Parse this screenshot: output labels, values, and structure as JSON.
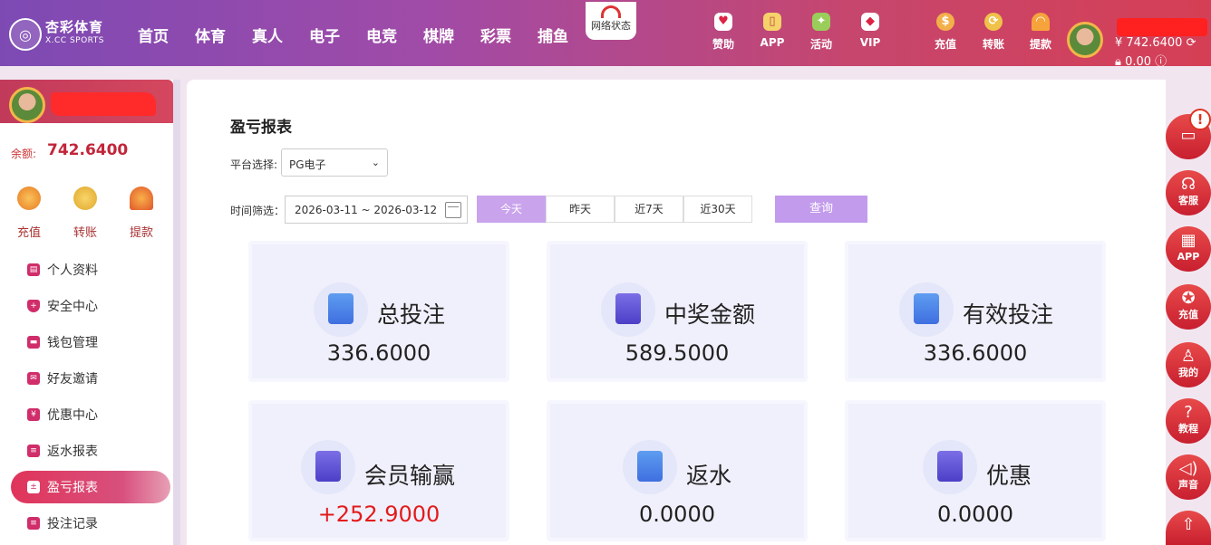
{
  "brand": {
    "cn": "杏彩体育",
    "en": "X.CC SPORTS"
  },
  "nav": [
    "首页",
    "体育",
    "真人",
    "电子",
    "电竞",
    "棋牌",
    "彩票",
    "捕鱼"
  ],
  "net_status": "网络状态",
  "top_icons": [
    {
      "label": "赞助",
      "icon": "heart-handshake-icon"
    },
    {
      "label": "APP",
      "icon": "phone-icon"
    },
    {
      "label": "活动",
      "icon": "gift-icon"
    },
    {
      "label": "VIP",
      "icon": "diamond-icon"
    },
    {
      "label": "充值",
      "icon": "money-bag-icon"
    },
    {
      "label": "转账",
      "icon": "dragon-icon"
    },
    {
      "label": "提款",
      "icon": "fan-icon"
    }
  ],
  "account": {
    "balance": "¥ 742.6400",
    "locked": "0.00"
  },
  "sidebar": {
    "balance_label": "余额:",
    "balance_value": "742.6400",
    "quick": [
      "充值",
      "转账",
      "提款"
    ],
    "menu": [
      "个人资料",
      "安全中心",
      "钱包管理",
      "好友邀请",
      "优惠中心",
      "返水报表",
      "盈亏报表",
      "投注记录"
    ],
    "active_index": 6
  },
  "main": {
    "title": "盈亏报表",
    "platform_label": "平台选择:",
    "platform_value": "PG电子",
    "time_label": "时间筛选：",
    "date_range": "2026-03-11 ~ 2026-03-12",
    "ranges": [
      "今天",
      "昨天",
      "近7天",
      "近30天"
    ],
    "query": "查询",
    "cards": [
      {
        "title": "总投注",
        "value": "336.6000"
      },
      {
        "title": "中奖金额",
        "value": "589.5000"
      },
      {
        "title": "有效投注",
        "value": "336.6000"
      },
      {
        "title": "会员输赢",
        "value": "+252.9000"
      },
      {
        "title": "返水",
        "value": "0.0000"
      },
      {
        "title": "优惠",
        "value": "0.0000"
      }
    ]
  },
  "right_float": [
    "客服",
    "APP",
    "充值",
    "我的",
    "教程",
    "声音"
  ]
}
